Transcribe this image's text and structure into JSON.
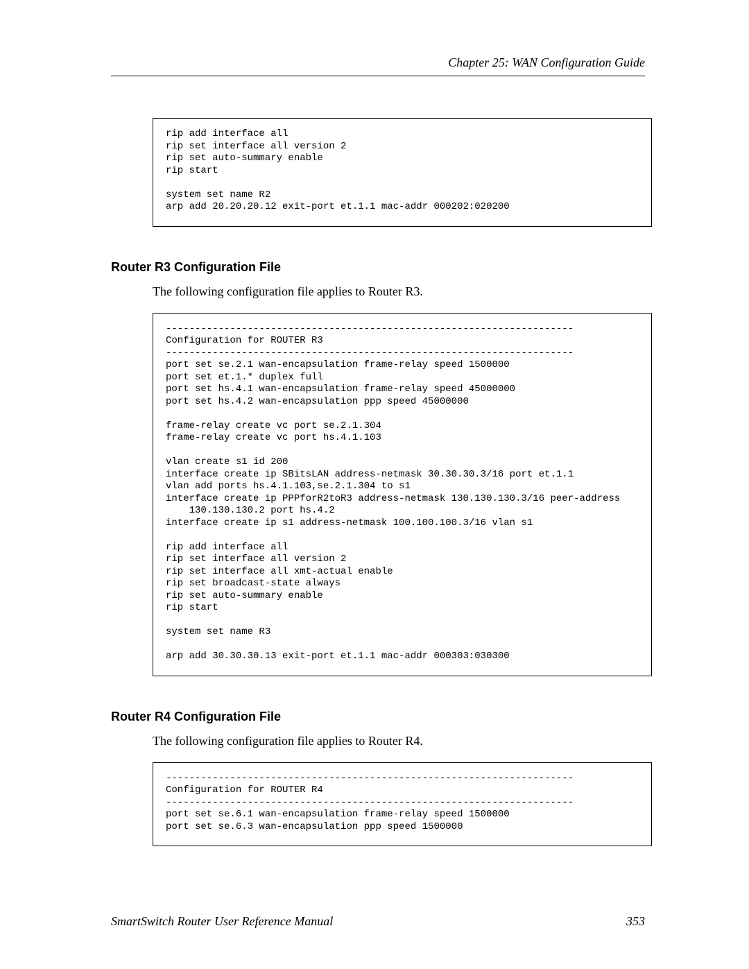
{
  "header": {
    "chapter": "Chapter 25: WAN Configuration Guide"
  },
  "block1": {
    "text": "rip add interface all\nrip set interface all version 2\nrip set auto-summary enable\nrip start\n\nsystem set name R2\narp add 20.20.20.12 exit-port et.1.1 mac-addr 000202:020200"
  },
  "section_r3": {
    "heading": "Router R3 Configuration File",
    "intro": "The following configuration file applies to Router R3.",
    "code": "----------------------------------------------------------------------\nConfiguration for ROUTER R3\n----------------------------------------------------------------------\nport set se.2.1 wan-encapsulation frame-relay speed 1500000\nport set et.1.* duplex full\nport set hs.4.1 wan-encapsulation frame-relay speed 45000000\nport set hs.4.2 wan-encapsulation ppp speed 45000000\n\nframe-relay create vc port se.2.1.304\nframe-relay create vc port hs.4.1.103\n\nvlan create s1 id 200\ninterface create ip SBitsLAN address-netmask 30.30.30.3/16 port et.1.1\nvlan add ports hs.4.1.103,se.2.1.304 to s1\ninterface create ip PPPforR2toR3 address-netmask 130.130.130.3/16 peer-address\n    130.130.130.2 port hs.4.2\ninterface create ip s1 address-netmask 100.100.100.3/16 vlan s1\n\nrip add interface all\nrip set interface all version 2\nrip set interface all xmt-actual enable\nrip set broadcast-state always\nrip set auto-summary enable\nrip start\n\nsystem set name R3\n\narp add 30.30.30.13 exit-port et.1.1 mac-addr 000303:030300"
  },
  "section_r4": {
    "heading": "Router R4 Configuration File",
    "intro": "The following configuration file applies to Router R4.",
    "code": "----------------------------------------------------------------------\nConfiguration for ROUTER R4\n----------------------------------------------------------------------\nport set se.6.1 wan-encapsulation frame-relay speed 1500000\nport set se.6.3 wan-encapsulation ppp speed 1500000"
  },
  "footer": {
    "manual": "SmartSwitch Router User Reference Manual",
    "page": "353"
  }
}
